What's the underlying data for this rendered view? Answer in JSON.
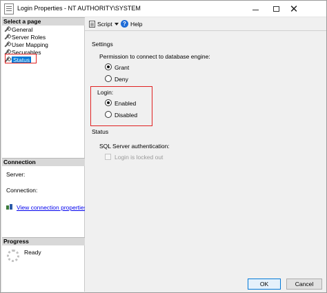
{
  "window": {
    "title": "Login Properties - NT AUTHORITY\\SYSTEM",
    "close_glyph": "✕"
  },
  "left": {
    "select_page_header": "Select a page",
    "pages": [
      {
        "label": "General",
        "icon": "wrench-icon"
      },
      {
        "label": "Server Roles",
        "icon": "wrench-icon"
      },
      {
        "label": "User Mapping",
        "icon": "wrench-icon"
      },
      {
        "label": "Securables",
        "icon": "wrench-icon"
      },
      {
        "label": "Status",
        "icon": "wrench-icon",
        "selected": true
      }
    ],
    "connection_header": "Connection",
    "server_label": "Server:",
    "connection_label": "Connection:",
    "view_connection_link": "View connection properties",
    "progress_header": "Progress",
    "progress_status": "Ready"
  },
  "toolbar": {
    "script_label": "Script",
    "help_label": "Help"
  },
  "settings": {
    "heading": "Settings",
    "permission_label": "Permission to connect to database engine:",
    "grant_label": "Grant",
    "deny_label": "Deny",
    "permission_value": "Grant",
    "login_label": "Login:",
    "enabled_label": "Enabled",
    "disabled_label": "Disabled",
    "login_value": "Enabled"
  },
  "status": {
    "heading": "Status",
    "sql_auth_label": "SQL Server authentication:",
    "locked_out_label": "Login is locked out",
    "locked_out_checked": false
  },
  "buttons": {
    "ok": "OK",
    "cancel": "Cancel"
  },
  "colors": {
    "selection": "#0078d7",
    "highlight_box": "#e02020",
    "link": "#0000ee"
  }
}
